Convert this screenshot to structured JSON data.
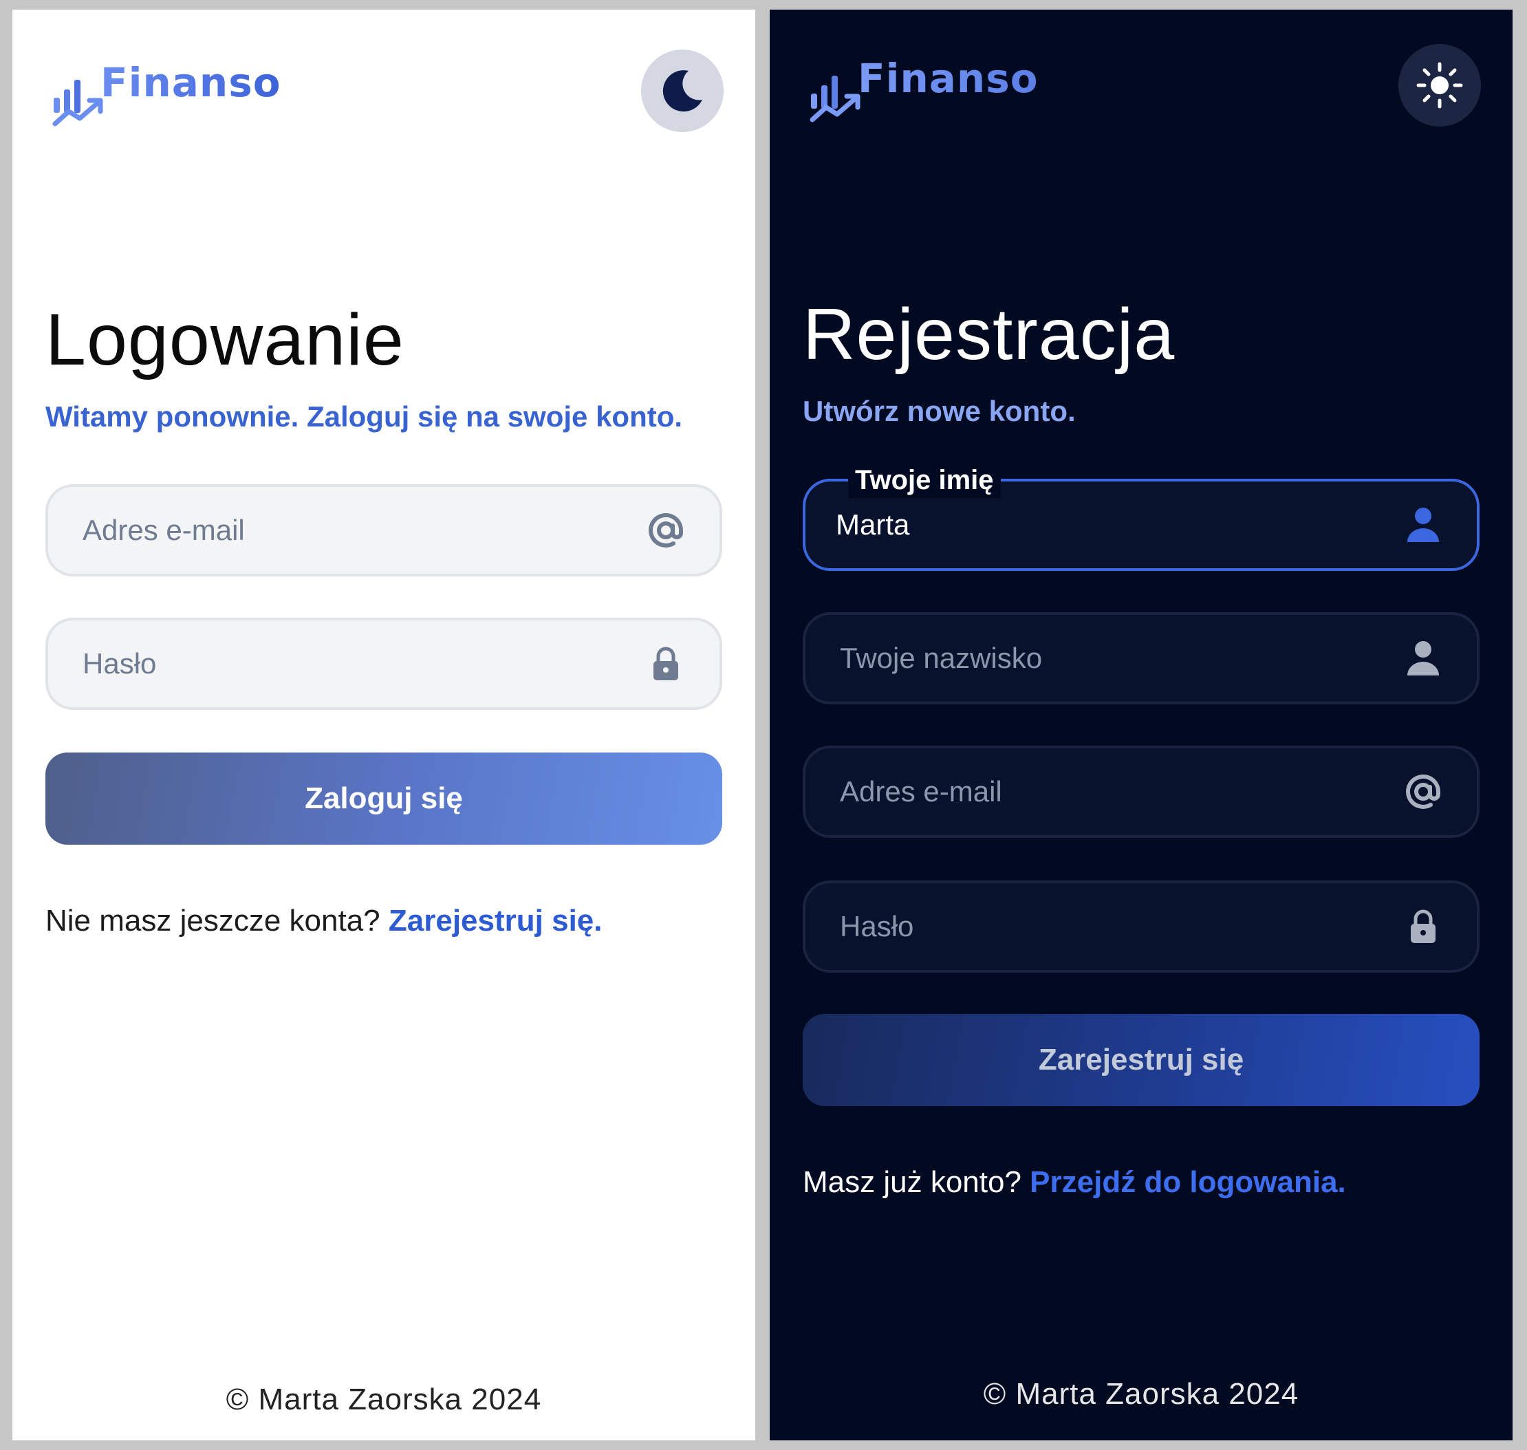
{
  "light": {
    "logo_text": "Finanso",
    "theme_toggle_icon": "moon-icon",
    "title": "Logowanie",
    "subtitle": "Witamy ponownie. Zaloguj się na swoje konto.",
    "email": {
      "value": "",
      "placeholder": "Adres e-mail",
      "icon": "at-icon"
    },
    "password": {
      "value": "",
      "placeholder": "Hasło",
      "icon": "lock-icon"
    },
    "submit_label": "Zaloguj się",
    "alt_text": "Nie masz jeszcze konta?",
    "alt_link": "Zarejestruj się.",
    "footer": "© Marta Zaorska 2024"
  },
  "dark": {
    "logo_text": "Finanso",
    "theme_toggle_icon": "sun-icon",
    "title": "Rejestracja",
    "subtitle": "Utwórz nowe konto.",
    "first_name": {
      "label": "Twoje imię",
      "value": "Marta",
      "icon": "user-icon"
    },
    "last_name": {
      "value": "",
      "placeholder": "Twoje nazwisko",
      "icon": "user-icon"
    },
    "email": {
      "value": "",
      "placeholder": "Adres e-mail",
      "icon": "at-icon"
    },
    "password": {
      "value": "",
      "placeholder": "Hasło",
      "icon": "lock-icon"
    },
    "submit_label": "Zarejestruj się",
    "alt_text": "Masz już konto?",
    "alt_link": "Przejdź do logowania.",
    "footer": "© Marta Zaorska 2024"
  },
  "colors": {
    "accent_light": "#2d5bd3",
    "accent_dark": "#3d6ef0",
    "dark_background": "#020a22",
    "light_background": "#ffffff"
  }
}
